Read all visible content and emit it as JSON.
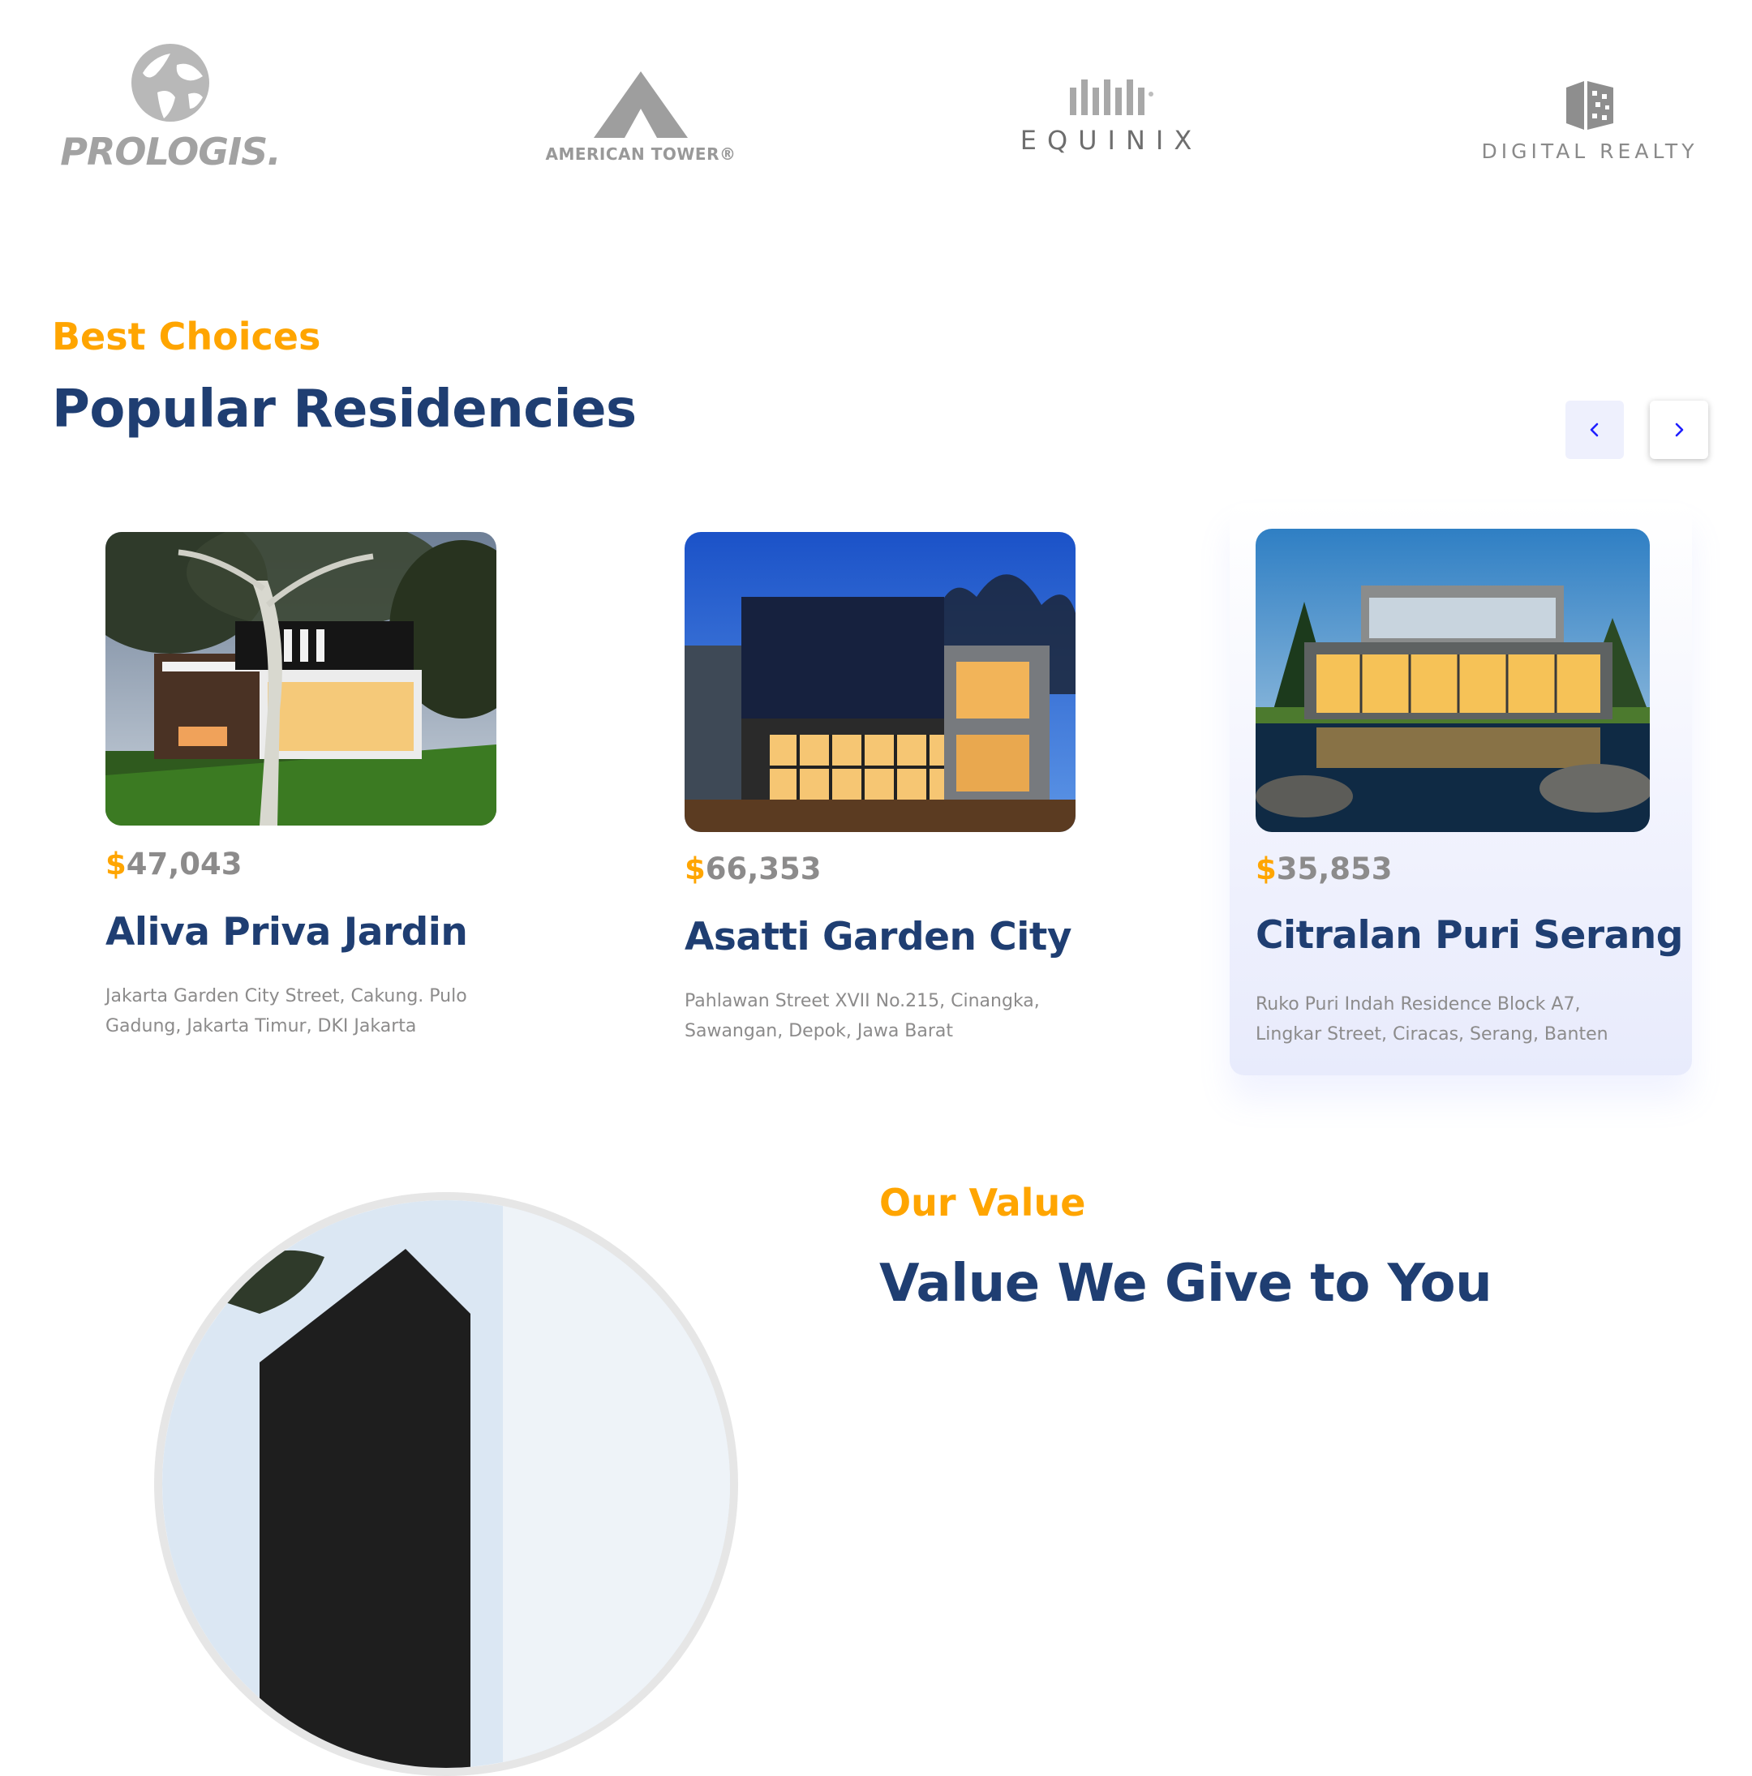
{
  "companies": {
    "prologis": "PROLOGIS.",
    "american_tower": "AMERICAN TOWER®",
    "equinix": "EQUINIX",
    "digital_realty": "DIGITAL REALTY"
  },
  "residencies": {
    "eyebrow": "Best Choices",
    "title": "Popular Residencies",
    "nav_prev_icon": "chevron-left-icon",
    "nav_next_icon": "chevron-right-icon",
    "cards": [
      {
        "currency": "$",
        "price": "47,043",
        "name": "Aliva Priva Jardin",
        "address_line1": "Jakarta Garden City Street, Cakung. Pulo",
        "address_line2": "Gadung, Jakarta Timur, DKI Jakarta"
      },
      {
        "currency": "$",
        "price": "66,353",
        "name": "Asatti Garden City",
        "address_line1": "Pahlawan Street XVII No.215, Cinangka,",
        "address_line2": "Sawangan, Depok, Jawa Barat"
      },
      {
        "currency": "$",
        "price": "35,853",
        "name": "Citralan Puri Serang",
        "address_line1": "Ruko Puri Indah Residence Block A7,",
        "address_line2": "Lingkar Street, Ciracas, Serang, Banten"
      }
    ]
  },
  "value": {
    "eyebrow": "Our Value",
    "title": "Value We Give to You"
  },
  "colors": {
    "accent_orange": "#ffa500",
    "title_blue": "#1f3e72",
    "text_gray": "#8c8b8b",
    "button_bg": "#eef0fd",
    "chevron_blue": "#1f1fff"
  }
}
